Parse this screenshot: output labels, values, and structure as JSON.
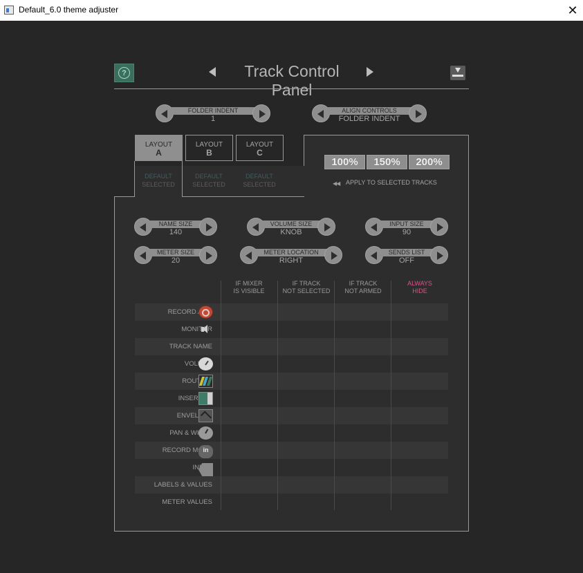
{
  "window": {
    "title": "Default_6.0 theme adjuster",
    "close_glyph": "✕"
  },
  "header": {
    "page_title": "Track Control Panel",
    "help_glyph": "?"
  },
  "top_controls": [
    {
      "label": "FOLDER INDENT",
      "value": "1"
    },
    {
      "label": "ALIGN CONTROLS",
      "value": "FOLDER INDENT"
    }
  ],
  "layouts": [
    {
      "line1": "LAYOUT",
      "line2": "A",
      "preset": "DEFAULT",
      "status": "SELECTED",
      "active": true
    },
    {
      "line1": "LAYOUT",
      "line2": "B",
      "preset": "DEFAULT",
      "status": "SELECTED",
      "active": false
    },
    {
      "line1": "LAYOUT",
      "line2": "C",
      "preset": "DEFAULT",
      "status": "SELECTED",
      "active": false
    }
  ],
  "scales": [
    "100%",
    "150%",
    "200%"
  ],
  "apply_label": "APPLY TO SELECTED TRACKS",
  "apply_glyph": "◀◀",
  "size_controls": [
    {
      "label": "NAME SIZE",
      "value": "140"
    },
    {
      "label": "VOLUME SIZE",
      "value": "KNOB"
    },
    {
      "label": "INPUT SIZE",
      "value": "90"
    },
    {
      "label": "METER SIZE",
      "value": "20"
    },
    {
      "label": "METER LOCATION",
      "value": "RIGHT"
    },
    {
      "label": "SENDS LIST",
      "value": "OFF"
    }
  ],
  "visibility_columns": [
    {
      "line1": "IF MIXER",
      "line2": "IS VISIBLE"
    },
    {
      "line1": "IF TRACK",
      "line2": "NOT SELECTED"
    },
    {
      "line1": "IF TRACK",
      "line2": "NOT ARMED"
    },
    {
      "line1": "ALWAYS",
      "line2": "HIDE"
    }
  ],
  "visibility_rows": [
    {
      "label": "RECORD ARM",
      "icon": "record-arm-icon"
    },
    {
      "label": "MONITOR",
      "icon": "monitor-speaker-icon"
    },
    {
      "label": "TRACK NAME",
      "icon": ""
    },
    {
      "label": "VOLUME",
      "icon": "volume-knob-icon"
    },
    {
      "label": "ROUTING",
      "icon": "routing-icon"
    },
    {
      "label": "INSERT FX",
      "icon": "insert-fx-icon"
    },
    {
      "label": "ENVELOPE",
      "icon": "envelope-icon"
    },
    {
      "label": "PAN & WIDTH",
      "icon": "pan-knob-icon"
    },
    {
      "label": "RECORD MODE",
      "icon": "record-mode-icon"
    },
    {
      "label": "INPUT",
      "icon": "input-icon"
    },
    {
      "label": "LABELS & VALUES",
      "icon": ""
    },
    {
      "label": "METER VALUES",
      "icon": ""
    }
  ],
  "record_mode_text": "in",
  "colors": {
    "always_hide": "#d9568a",
    "help_green": "#3b6e5d",
    "routing_stripes": [
      "#c9c43a",
      "#4aa3c9",
      "#3a7d5a"
    ]
  }
}
